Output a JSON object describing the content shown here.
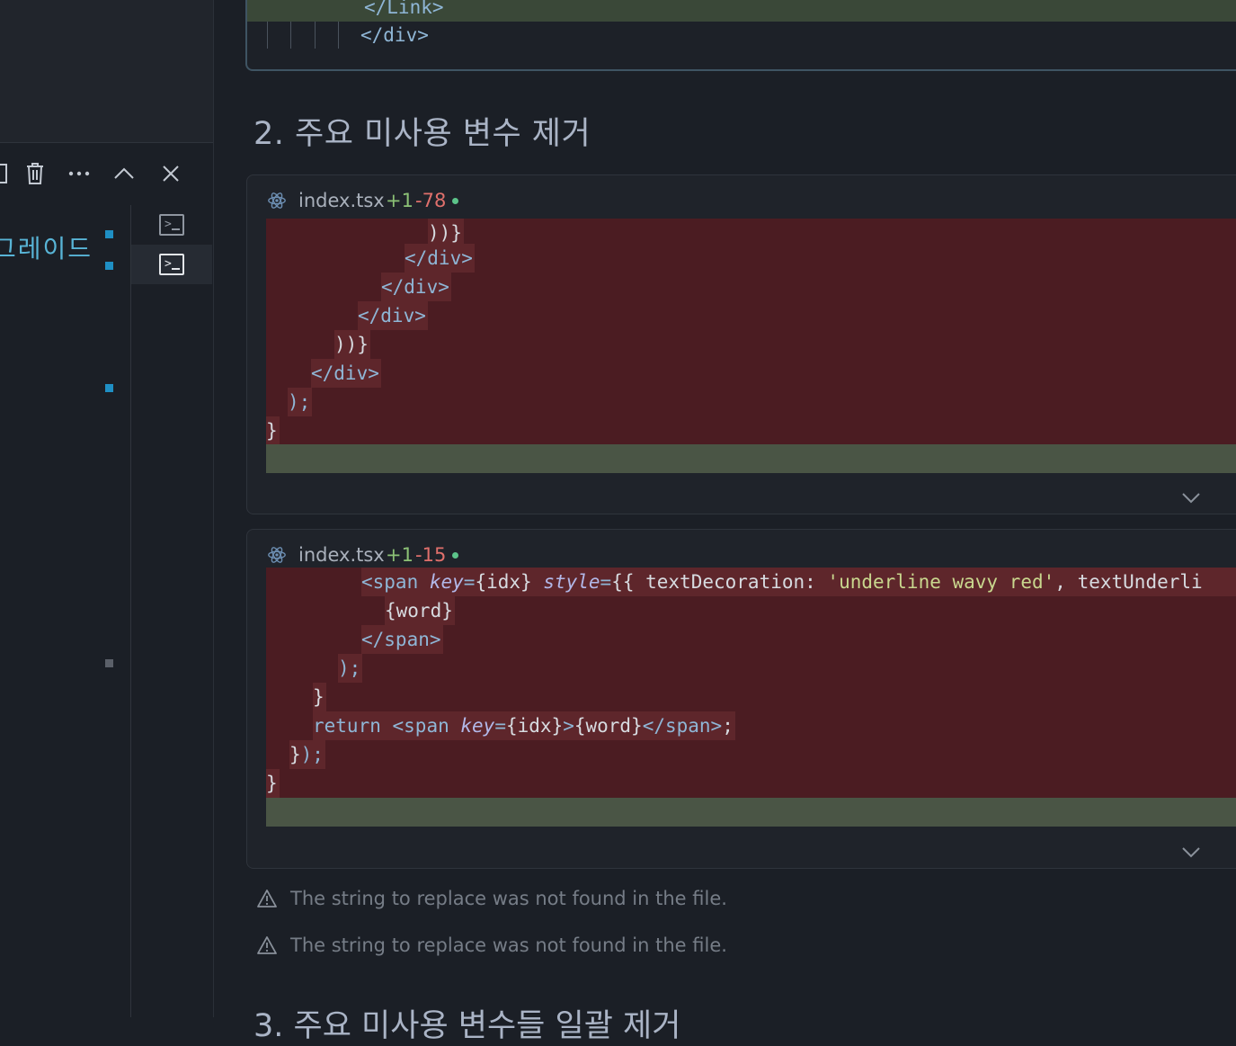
{
  "left_panel": {
    "toolbar": {
      "delete_icon": "trash-icon",
      "more_icon": "ellipsis-icon",
      "collapse_icon": "chevron-up-icon",
      "close_icon": "close-icon"
    },
    "terminal_label": "그레이드"
  },
  "top_block": {
    "lines": [
      "</Link>",
      "</div>"
    ]
  },
  "section_2": {
    "title": "2. 주요 미사용 변수 제거"
  },
  "diff_1": {
    "file_name": "index.tsx",
    "additions": "+1",
    "deletions": "-78"
  },
  "diff_2": {
    "file_name": "index.tsx",
    "additions": "+1",
    "deletions": "-15"
  },
  "warnings": [
    "The string to replace was not found in the file.",
    "The string to replace was not found in the file."
  ],
  "section_3": {
    "title": "3. 주요 미사용 변수들 일괄 제거"
  },
  "colors": {
    "accent": "#1f8fc4",
    "deleted_bg": "#4b1c22",
    "inserted_bg": "#4a5545",
    "additions": "#8cc176",
    "deletions": "#e0706c"
  }
}
